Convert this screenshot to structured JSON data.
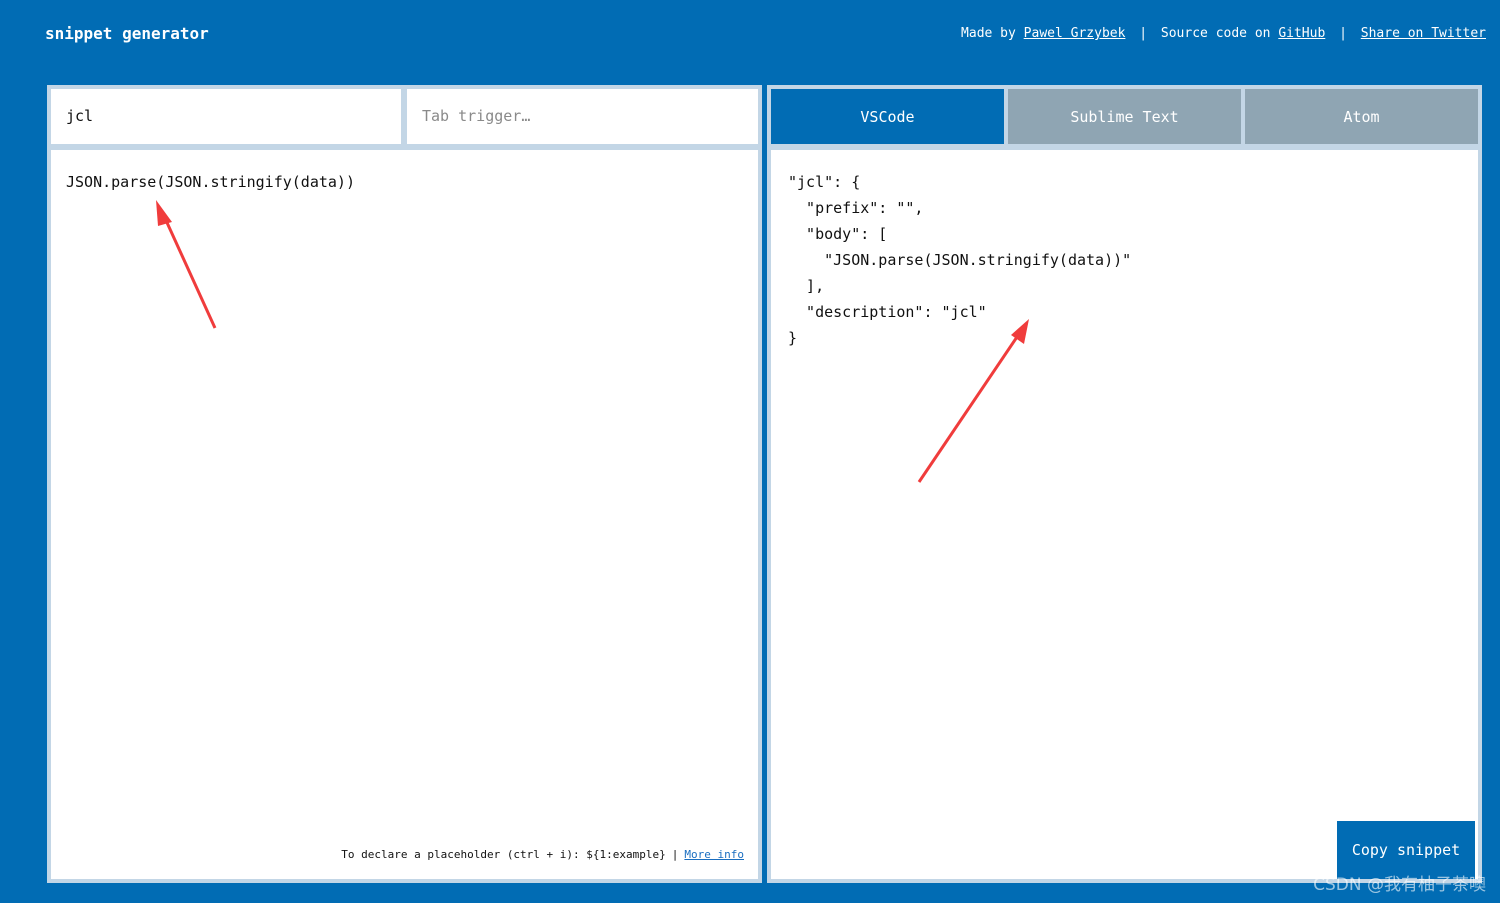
{
  "header": {
    "title": "snippet generator",
    "made_by_prefix": "Made by",
    "author_link": "Pawel Grzybek",
    "source_prefix": "Source code on",
    "github_link": "GitHub",
    "share_link": "Share on Twitter",
    "separator": "|"
  },
  "editor": {
    "description_value": "jcl",
    "trigger_placeholder": "Tab trigger…",
    "code": "JSON.parse(JSON.stringify(data))",
    "hint_text": "To declare a placeholder (ctrl + i): ${1:example}",
    "hint_link": "More info"
  },
  "tabs": [
    {
      "label": "VSCode",
      "active": true
    },
    {
      "label": "Sublime Text",
      "active": false
    },
    {
      "label": "Atom",
      "active": false
    }
  ],
  "output": {
    "lines": [
      "\"jcl\": {",
      "  \"prefix\": \"\",",
      "  \"body\": [",
      "    \"JSON.parse(JSON.stringify(data))\"",
      "  ],",
      "  \"description\": \"jcl\"",
      "}"
    ]
  },
  "copy_button": "Copy snippet",
  "watermark": "CSDN @我有柚子茶噢",
  "colors": {
    "background": "#016cb4",
    "active_tab": "#016cb4",
    "inactive_tab": "#8fa5b3",
    "annotation_arrow": "#f03c3c"
  }
}
